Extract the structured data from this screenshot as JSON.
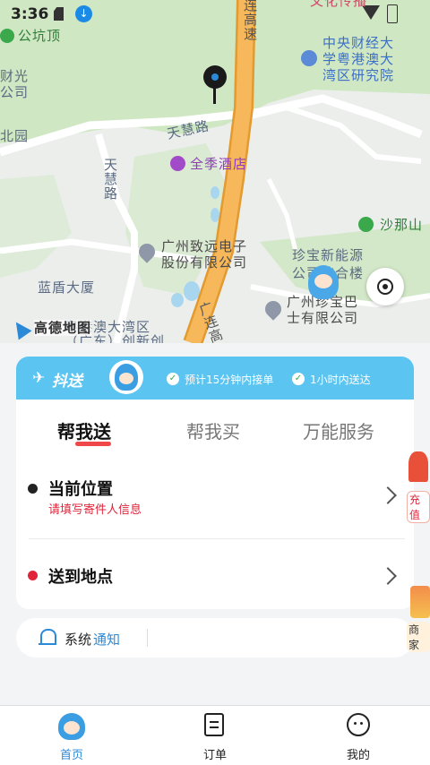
{
  "status_bar": {
    "time": "3:36"
  },
  "map": {
    "labels": {
      "gongkengding": "公坑顶",
      "caiguang": "财光",
      "gongsi_left": "公司",
      "beiyuan": "北园",
      "lianhe_gaosu": "连高速",
      "zhongyang": "中央财经大",
      "xue_yue": "学粤港澳大",
      "wanqu": "湾区研究院",
      "tianhui_lu": "天慧路",
      "tianhui_vertical": "天慧路",
      "quanji": "全季酒店",
      "shanaishan": "沙那山",
      "zhiyuan1": "广州致远电子",
      "zhiyuan2": "股份有限公司",
      "zhenbao_ny": "珍宝新能源",
      "zhenbao_ny2": "公司综合楼",
      "landun": "蓝盾大厦",
      "zhenbao_bs1": "广州珍宝巴",
      "zhenbao_bs2": "士有限公司",
      "guanglian": "广连高",
      "yuegang": "粤港澳大湾区",
      "guangdong": "（广东）创新创",
      "wenhua": "文化传播",
      "gaode": "高德地图"
    }
  },
  "banner": {
    "brand": "抖送",
    "feature1": "预计15分钟内接单",
    "feature2": "1小时内送达"
  },
  "tabs": {
    "active": "帮我送",
    "buy": "帮我买",
    "service": "万能服务"
  },
  "sender": {
    "title": "当前位置",
    "hint": "请填写寄件人信息"
  },
  "receiver": {
    "title": "送到地点"
  },
  "notice": {
    "prefix": "系统",
    "highlight": "通知"
  },
  "side_badges": {
    "recharge": "充值",
    "merchant": "商家"
  },
  "nav": {
    "home": "首页",
    "orders": "订单",
    "mine": "我的"
  },
  "colors": {
    "accent": "#5bc4f1",
    "active_tab_underline": "#f04848",
    "link": "#2b8ad8",
    "road": "#f4b04a"
  }
}
